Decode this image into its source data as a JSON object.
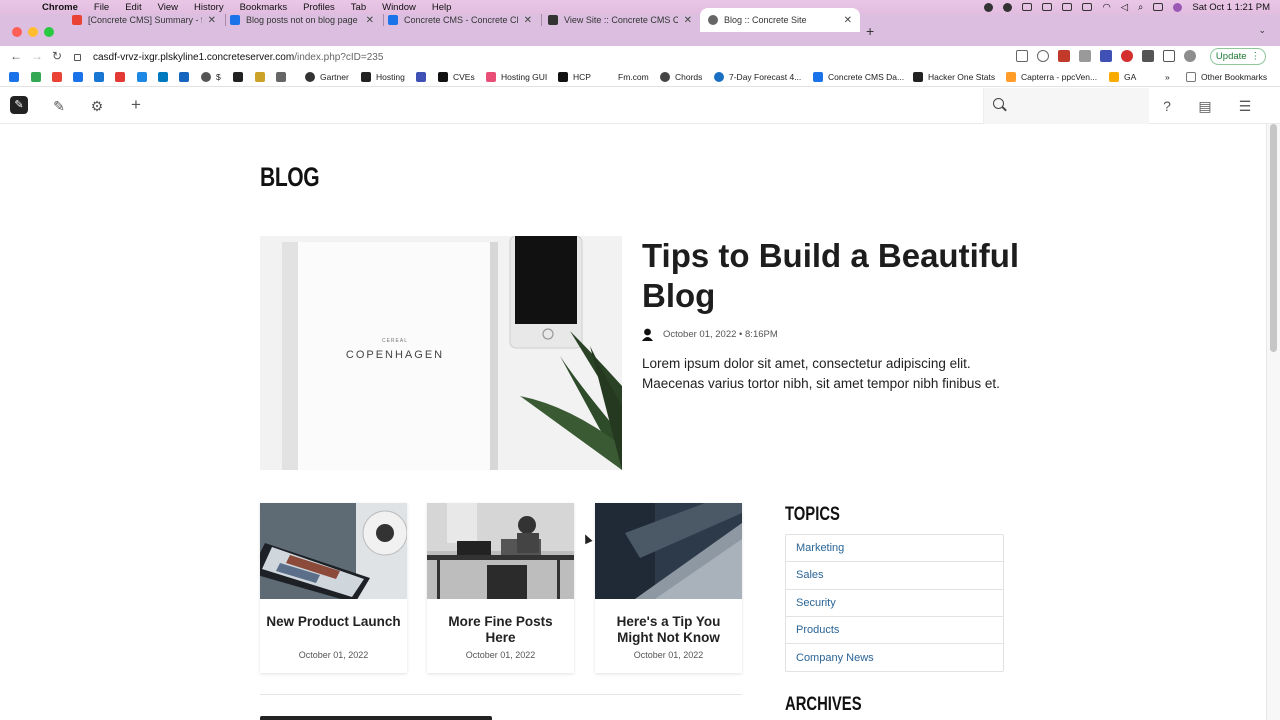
{
  "menubar": {
    "app": "Chrome",
    "items": [
      "File",
      "Edit",
      "View",
      "History",
      "Bookmarks",
      "Profiles",
      "Tab",
      "Window",
      "Help"
    ],
    "clock": "Sat Oct 1  1:21 PM"
  },
  "tabs": [
    {
      "title": "[Concrete CMS] Summary - fr",
      "favicon_color": "#ea4335"
    },
    {
      "title": "Blog posts not on blog page - (",
      "favicon_color": "#1a73e8"
    },
    {
      "title": "Concrete CMS - Concrete CMS",
      "favicon_color": "#1a73e8"
    },
    {
      "title": "View Site :: Concrete CMS Cor",
      "favicon_color": "#333333"
    },
    {
      "title": "Blog :: Concrete Site",
      "favicon_color": "#666666",
      "active": true
    }
  ],
  "address": {
    "host": "casdf-vrvz-ixgr.plskyline1.concreteserver.com",
    "path": "/index.php?cID=235"
  },
  "update_label": "Update",
  "bookmarks": [
    {
      "label": "$",
      "color": "#555"
    },
    {
      "label": "Gartner",
      "color": "#333"
    },
    {
      "label": "Hosting",
      "color": "#222"
    },
    {
      "label": "CVEs",
      "color": "#111"
    },
    {
      "label": "Hosting GUI",
      "color": "#e94e77"
    },
    {
      "label": "HCP",
      "color": "#111"
    },
    {
      "label": "Fm.com",
      "color": "#ffffff"
    },
    {
      "label": "Chords",
      "color": "#444"
    },
    {
      "label": "7-Day Forecast 4...",
      "color": "#1b6fc2"
    },
    {
      "label": "Concrete CMS Da...",
      "color": "#1a73e8"
    },
    {
      "label": "Hacker One Stats",
      "color": "#222"
    },
    {
      "label": "Capterra - ppcVen...",
      "color": "#ff9d28"
    },
    {
      "label": "GA",
      "color": "#f9ab00"
    },
    {
      "label": "»",
      "color": "#ffffff"
    },
    {
      "label": "Other Bookmarks",
      "color": "#777"
    }
  ],
  "page": {
    "heading": "BLOG",
    "featured": {
      "title": "Tips to Build a Beautiful Blog",
      "meta": "October 01, 2022 • 8:16PM",
      "excerpt": "Lorem ipsum dolor sit amet, consectetur adipiscing elit. Maecenas varius tortor nibh, sit amet tempor nibh finibus et.",
      "image_text": "COPENHAGEN",
      "image_subtext": "CEREAL"
    },
    "posts": [
      {
        "title": "New Product Launch",
        "date": "October 01, 2022"
      },
      {
        "title": "More Fine Posts Here",
        "date": "October 01, 2022"
      },
      {
        "title": "Here's a Tip You Might Not Know",
        "date": "October 01, 2022"
      }
    ],
    "topics_heading": "TOPICS",
    "topics": [
      "Marketing",
      "Sales",
      "Security",
      "Products",
      "Company News"
    ],
    "archives_heading": "ARCHIVES"
  },
  "colors": {
    "menubar": "#e6c2e3",
    "tabstrip": "#dcbfe0",
    "link": "#2a6496",
    "update": "#1e7a35"
  }
}
